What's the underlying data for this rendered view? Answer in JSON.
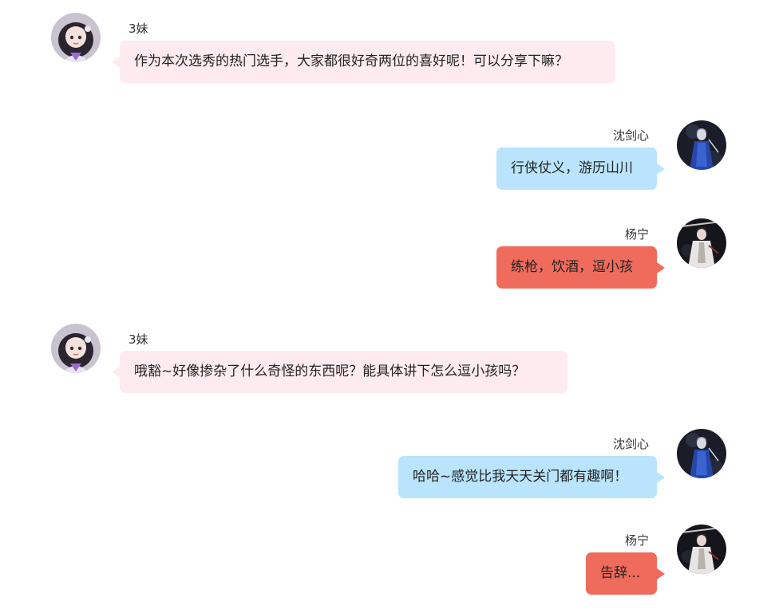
{
  "messages": [
    {
      "sender": "3妹",
      "avatar_icon": "girl-avatar-icon",
      "text": "作为本次选秀的热门选手，大家都很好奇两位的喜好呢！可以分享下嘛？"
    },
    {
      "sender": "沈剑心",
      "avatar_icon": "swordsman-blue-avatar-icon",
      "text": "行侠仗义，游历山川"
    },
    {
      "sender": "杨宁",
      "avatar_icon": "spearman-white-avatar-icon",
      "text": "练枪，饮酒，逗小孩"
    },
    {
      "sender": "3妹",
      "avatar_icon": "girl-avatar-icon",
      "text": "哦豁~好像掺杂了什么奇怪的东西呢？能具体讲下怎么逗小孩吗？"
    },
    {
      "sender": "沈剑心",
      "avatar_icon": "swordsman-blue-avatar-icon",
      "text": "哈哈~感觉比我天天关门都有趣啊！"
    },
    {
      "sender": "杨宁",
      "avatar_icon": "spearman-white-avatar-icon",
      "text": "告辞..."
    }
  ],
  "colors": {
    "host_bubble": "#fdebef",
    "shen_bubble": "#b9e4fb",
    "yang_bubble": "#ef6b5c"
  }
}
